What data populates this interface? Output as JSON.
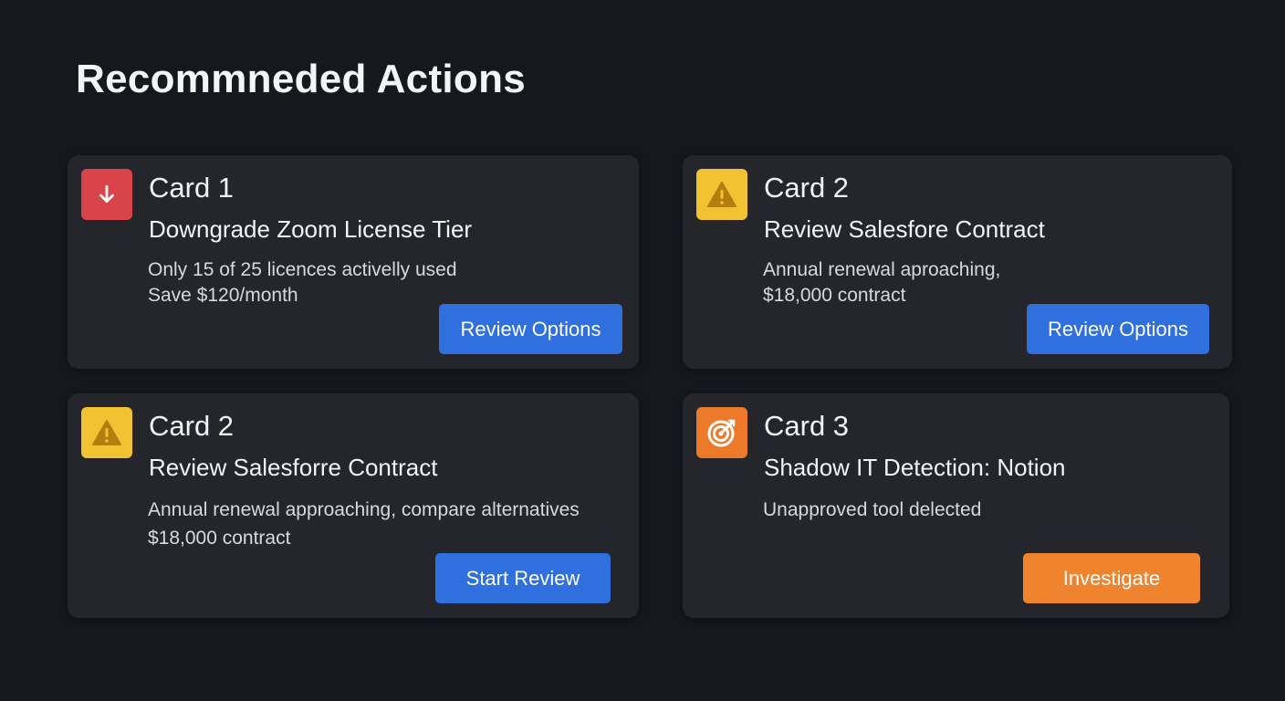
{
  "page": {
    "title": "Recommneded Actions"
  },
  "colors": {
    "background": "#16181d",
    "card": "#24262c",
    "danger": "#d9444b",
    "warning": "#f1c232",
    "alert": "#ec7a2a",
    "primary_button": "#2f6fde",
    "orange_button": "#f0832e"
  },
  "cards": [
    {
      "label": "Card 1",
      "icon": "arrow-down-icon",
      "title": "Downgrade Zoom License Tier",
      "desc_line1": "Only 15 of 25 licences activelly used",
      "desc_line2": "Save $120/month",
      "button": "Review Options"
    },
    {
      "label": "Card 2",
      "icon": "warning-icon",
      "title": "Review Salesfore Contract",
      "desc_line1": "Annual renewal aproaching,",
      "desc_line2": "$18,000 contract",
      "button": "Review Options"
    },
    {
      "label": "Card 2",
      "icon": "warning-icon",
      "title": "Review Salesforre Contract",
      "desc_line1": "Annual renewal approaching, compare alternatives",
      "desc_line2": "$18,000 contract",
      "button": "Start Review"
    },
    {
      "label": "Card 3",
      "icon": "target-icon",
      "title": "Shadow IT Detection: Notion",
      "desc_line1": "Unapproved tool delected",
      "button": "Investigate"
    }
  ]
}
